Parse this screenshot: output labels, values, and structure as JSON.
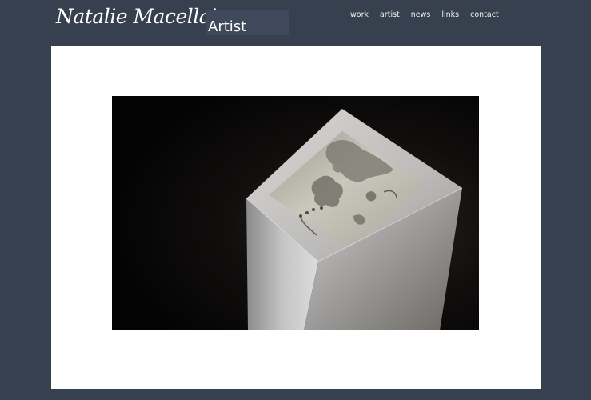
{
  "header": {
    "site_name": "Natalie Macellaio",
    "subtitle": "Artist"
  },
  "nav": {
    "items": [
      {
        "label": "work"
      },
      {
        "label": "artist"
      },
      {
        "label": "news"
      },
      {
        "label": "links"
      },
      {
        "label": "contact"
      }
    ]
  },
  "artwork": {
    "description_icon": "pedestal-sculpture-photo"
  },
  "colors": {
    "page_background": "#37404f",
    "content_background": "#ffffff",
    "subtitle_box": "#3e4a5b",
    "text": "#ffffff"
  }
}
